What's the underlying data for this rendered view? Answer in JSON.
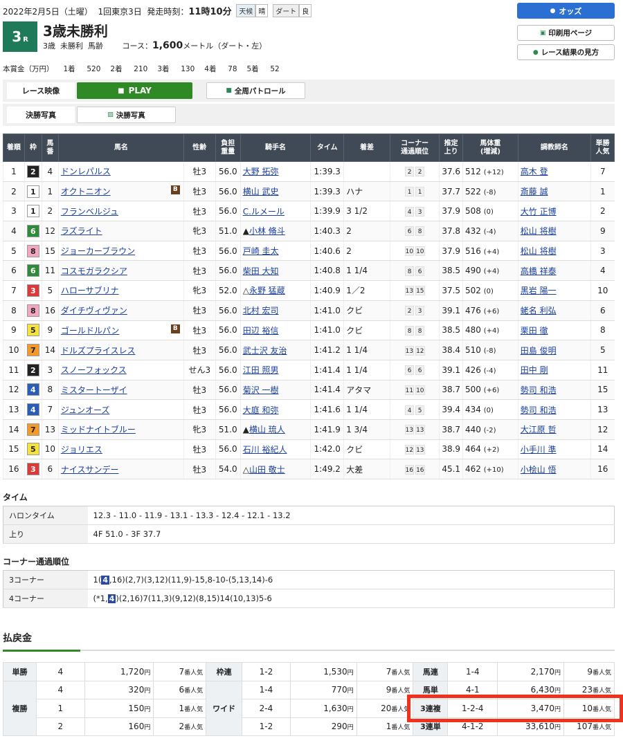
{
  "header": {
    "date": "2022年2月5日（土曜）",
    "meeting": "1回東京3日",
    "start_label": "発走時刻：",
    "start_time": "11時10分",
    "weather_label": "天候",
    "weather": "晴",
    "track_label": "ダート",
    "track_cond": "良",
    "race_no": "3",
    "race_no_suffix": "R",
    "race_title": "3歳未勝利",
    "cond1": "3歳",
    "cond2": "未勝利",
    "cond3": "馬齢",
    "course_label": "コース：",
    "distance": "1,600",
    "distance_unit": "メートル（ダート・左）"
  },
  "prize": {
    "label": "本賞金（万円）",
    "items": [
      {
        "place": "1着",
        "amount": "520"
      },
      {
        "place": "2着",
        "amount": "210"
      },
      {
        "place": "3着",
        "amount": "130"
      },
      {
        "place": "4着",
        "amount": "78"
      },
      {
        "place": "5着",
        "amount": "52"
      }
    ]
  },
  "buttons": {
    "odds": "オッズ",
    "print": "印刷用ページ",
    "howto": "レース結果の見方",
    "video_label": "レース映像",
    "play": "PLAY",
    "patrol": "全周パトロール",
    "photo_label": "決勝写真",
    "photo_btn": "決勝写真"
  },
  "table_headers": [
    "着順",
    "枠",
    "馬番",
    "馬名",
    "性齢",
    "負担重量",
    "騎手名",
    "タイム",
    "着差",
    "コーナー通過順位",
    "推定上り",
    "馬体重(増減)",
    "調教師名",
    "単勝人気"
  ],
  "results": [
    {
      "pos": "1",
      "waku": "2",
      "num": "4",
      "horse": "ドンレパルス",
      "b": "",
      "sex": "牡3",
      "wt": "56.0",
      "jockey": "大野 拓弥",
      "mark": "",
      "time": "1:39.3",
      "margin": "",
      "c1": "2",
      "c2": "2",
      "agari": "37.6",
      "bw": "512",
      "bwd": "(+12)",
      "trainer": "高木 登",
      "pop": "7"
    },
    {
      "pos": "2",
      "waku": "1",
      "num": "1",
      "horse": "オクトニオン",
      "b": "B",
      "sex": "牡3",
      "wt": "56.0",
      "jockey": "横山 武史",
      "mark": "",
      "time": "1:39.3",
      "margin": "ハナ",
      "c1": "1",
      "c2": "1",
      "agari": "37.7",
      "bw": "522",
      "bwd": "(-8)",
      "trainer": "斎藤 誠",
      "pop": "1"
    },
    {
      "pos": "3",
      "waku": "1",
      "num": "2",
      "horse": "フランベルジュ",
      "b": "",
      "sex": "牡3",
      "wt": "56.0",
      "jockey": "C.ルメール",
      "mark": "",
      "time": "1:39.9",
      "margin": "3 1/2",
      "c1": "4",
      "c2": "3",
      "agari": "37.9",
      "bw": "508",
      "bwd": "(0)",
      "trainer": "大竹 正博",
      "pop": "2"
    },
    {
      "pos": "4",
      "waku": "6",
      "num": "12",
      "horse": "ラズライト",
      "b": "",
      "sex": "牝3",
      "wt": "51.0",
      "jockey": "小林 脩斗",
      "mark": "▲",
      "time": "1:40.3",
      "margin": "2",
      "c1": "6",
      "c2": "8",
      "agari": "37.8",
      "bw": "432",
      "bwd": "(-4)",
      "trainer": "松山 将樹",
      "pop": "9"
    },
    {
      "pos": "5",
      "waku": "8",
      "num": "15",
      "horse": "ジョーカーブラウン",
      "b": "",
      "sex": "牡3",
      "wt": "56.0",
      "jockey": "戸崎 圭太",
      "mark": "",
      "time": "1:40.6",
      "margin": "2",
      "c1": "10",
      "c2": "10",
      "agari": "37.9",
      "bw": "516",
      "bwd": "(+4)",
      "trainer": "松山 将樹",
      "pop": "3"
    },
    {
      "pos": "6",
      "waku": "6",
      "num": "11",
      "horse": "コスモガラクシア",
      "b": "",
      "sex": "牡3",
      "wt": "56.0",
      "jockey": "柴田 大知",
      "mark": "",
      "time": "1:40.8",
      "margin": "1 1/4",
      "c1": "8",
      "c2": "6",
      "agari": "38.5",
      "bw": "490",
      "bwd": "(+4)",
      "trainer": "高橋 祥泰",
      "pop": "4"
    },
    {
      "pos": "7",
      "waku": "3",
      "num": "5",
      "horse": "ハローサブリナ",
      "b": "",
      "sex": "牝3",
      "wt": "52.0",
      "jockey": "永野 猛蔵",
      "mark": "△",
      "time": "1:40.9",
      "margin": "1／2",
      "c1": "13",
      "c2": "15",
      "agari": "37.5",
      "bw": "502",
      "bwd": "(0)",
      "trainer": "黒岩 陽一",
      "pop": "10"
    },
    {
      "pos": "8",
      "waku": "8",
      "num": "16",
      "horse": "ダイチヴィヴァン",
      "b": "",
      "sex": "牡3",
      "wt": "56.0",
      "jockey": "北村 宏司",
      "mark": "",
      "time": "1:41.0",
      "margin": "クビ",
      "c1": "2",
      "c2": "3",
      "agari": "39.1",
      "bw": "476",
      "bwd": "(+6)",
      "trainer": "蛯名 利弘",
      "pop": "6"
    },
    {
      "pos": "9",
      "waku": "5",
      "num": "9",
      "horse": "ゴールドルパン",
      "b": "B",
      "sex": "牡3",
      "wt": "56.0",
      "jockey": "田辺 裕信",
      "mark": "",
      "time": "1:41.0",
      "margin": "クビ",
      "c1": "8",
      "c2": "8",
      "agari": "38.5",
      "bw": "480",
      "bwd": "(+4)",
      "trainer": "栗田 徹",
      "pop": "8"
    },
    {
      "pos": "10",
      "waku": "7",
      "num": "14",
      "horse": "ドルズプライスレス",
      "b": "",
      "sex": "牡3",
      "wt": "56.0",
      "jockey": "武士沢 友治",
      "mark": "",
      "time": "1:41.2",
      "margin": "1 1/4",
      "c1": "13",
      "c2": "12",
      "agari": "38.4",
      "bw": "510",
      "bwd": "(-8)",
      "trainer": "田島 俊明",
      "pop": "5"
    },
    {
      "pos": "11",
      "waku": "2",
      "num": "3",
      "horse": "スノーフォックス",
      "b": "",
      "sex": "せん3",
      "wt": "56.0",
      "jockey": "江田 照男",
      "mark": "",
      "time": "1:41.4",
      "margin": "1 1/4",
      "c1": "6",
      "c2": "6",
      "agari": "39.1",
      "bw": "426",
      "bwd": "(-4)",
      "trainer": "田中 剛",
      "pop": "11"
    },
    {
      "pos": "12",
      "waku": "4",
      "num": "8",
      "horse": "ミスタートーザイ",
      "b": "",
      "sex": "牡3",
      "wt": "56.0",
      "jockey": "菊沢 一樹",
      "mark": "",
      "time": "1:41.4",
      "margin": "アタマ",
      "c1": "11",
      "c2": "10",
      "agari": "38.7",
      "bw": "500",
      "bwd": "(+6)",
      "trainer": "勢司 和浩",
      "pop": "15"
    },
    {
      "pos": "13",
      "waku": "4",
      "num": "7",
      "horse": "ジュンオーズ",
      "b": "",
      "sex": "牡3",
      "wt": "56.0",
      "jockey": "大庭 和弥",
      "mark": "",
      "time": "1:41.6",
      "margin": "1 1/4",
      "c1": "4",
      "c2": "5",
      "agari": "39.4",
      "bw": "434",
      "bwd": "(0)",
      "trainer": "勢司 和浩",
      "pop": "13"
    },
    {
      "pos": "14",
      "waku": "7",
      "num": "13",
      "horse": "ミッドナイトブルー",
      "b": "",
      "sex": "牝3",
      "wt": "51.0",
      "jockey": "横山 琉人",
      "mark": "▲",
      "time": "1:41.9",
      "margin": "1 3/4",
      "c1": "13",
      "c2": "13",
      "agari": "38.7",
      "bw": "440",
      "bwd": "(-2)",
      "trainer": "大江原 哲",
      "pop": "12"
    },
    {
      "pos": "15",
      "waku": "5",
      "num": "10",
      "horse": "ジョリエス",
      "b": "",
      "sex": "牡3",
      "wt": "56.0",
      "jockey": "石川 裕紀人",
      "mark": "",
      "time": "1:42.0",
      "margin": "クビ",
      "c1": "12",
      "c2": "13",
      "agari": "38.9",
      "bw": "464",
      "bwd": "(+2)",
      "trainer": "小手川 準",
      "pop": "14"
    },
    {
      "pos": "16",
      "waku": "3",
      "num": "6",
      "horse": "ナイスサンデー",
      "b": "",
      "sex": "牡3",
      "wt": "54.0",
      "jockey": "山田 敬士",
      "mark": "△",
      "time": "1:49.2",
      "margin": "大差",
      "c1": "16",
      "c2": "16",
      "agari": "45.1",
      "bw": "462",
      "bwd": "(+10)",
      "trainer": "小桧山 悟",
      "pop": "16"
    }
  ],
  "time_section": {
    "title": "タイム",
    "halon_label": "ハロンタイム",
    "halon": "12.3 - 11.0 - 11.9 - 13.1 - 13.3 - 12.4 - 12.1 - 13.2",
    "agari_label": "上り",
    "agari": "4F 51.0 - 3F 37.7"
  },
  "corner_section": {
    "title": "コーナー通過順位",
    "c3_label": "3コーナー",
    "c3_pre": "1(",
    "c3_hl": "4",
    "c3_post": ",16)(2,7)(3,12)(11,9)-15,8-10-(5,13,14)-6",
    "c4_label": "4コーナー",
    "c4_pre": "(*1,",
    "c4_hl": "4",
    "c4_post": ")(2,16)7(11,3)(9,12)(8,15)14(10,13)5-6"
  },
  "payout": {
    "title": "払戻金",
    "yen": "円",
    "ninki": "番人気",
    "tansho_label": "単勝",
    "tansho": {
      "num": "4",
      "amt": "1,720",
      "pop": "7"
    },
    "fukusho_label": "複勝",
    "fukusho": [
      {
        "num": "4",
        "amt": "320",
        "pop": "6"
      },
      {
        "num": "1",
        "amt": "150",
        "pop": "1"
      },
      {
        "num": "2",
        "amt": "160",
        "pop": "2"
      }
    ],
    "wakuren_label": "枠連",
    "wakuren": {
      "num": "1-2",
      "amt": "1,530",
      "pop": "7"
    },
    "wide_label": "ワイド",
    "wide": [
      {
        "num": "1-4",
        "amt": "770",
        "pop": "9"
      },
      {
        "num": "2-4",
        "amt": "1,630",
        "pop": "20"
      },
      {
        "num": "1-2",
        "amt": "290",
        "pop": "1"
      }
    ],
    "umaren_label": "馬連",
    "umaren": {
      "num": "1-4",
      "amt": "2,170",
      "pop": "9"
    },
    "umatan_label": "馬単",
    "umatan": {
      "num": "4-1",
      "amt": "6,430",
      "pop": "23"
    },
    "sanrenpuku_label": "3連複",
    "sanrenpuku": {
      "num": "1-2-4",
      "amt": "3,470",
      "pop": "10"
    },
    "sanrentan_label": "3連単",
    "sanrentan": {
      "num": "4-1-2",
      "amt": "33,610",
      "pop": "107"
    }
  },
  "colors": {
    "waku": {
      "1": "#ffffff",
      "2": "#222222",
      "3": "#d93a3a",
      "4": "#2a5db8",
      "5": "#f5e23a",
      "6": "#2f8a3a",
      "7": "#f39a2a",
      "8": "#f3a7be"
    },
    "waku_text": {
      "1": "#222",
      "2": "#fff",
      "3": "#fff",
      "4": "#fff",
      "5": "#222",
      "6": "#fff",
      "7": "#222",
      "8": "#222"
    },
    "highlight": "#f0321c"
  }
}
